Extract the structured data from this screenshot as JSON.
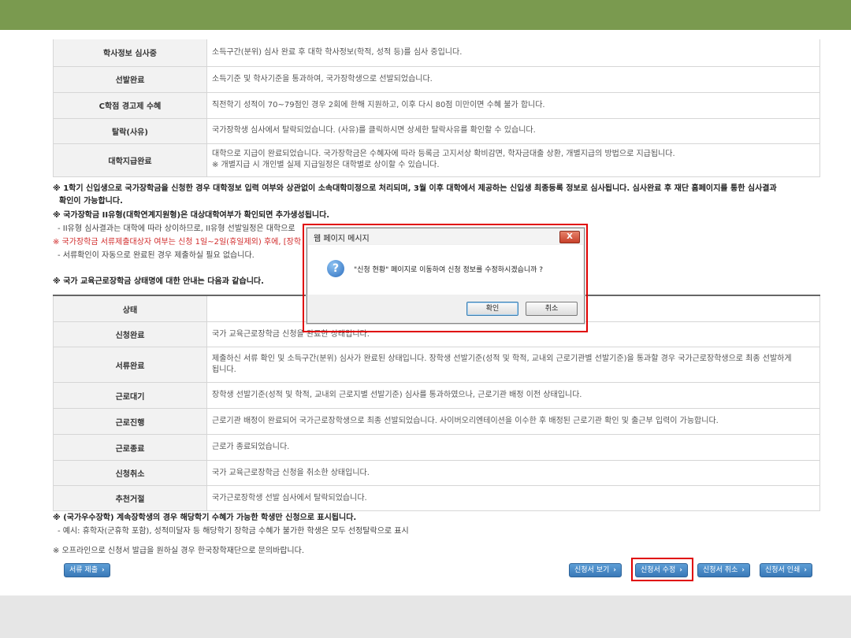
{
  "table1": [
    {
      "label": "학사정보 심사중",
      "desc": [
        "소득구간(분위) 심사 완료 후 대학 학사정보(학적, 성적 등)를 심사 중입니다."
      ]
    },
    {
      "label": "선발완료",
      "desc": [
        "소득기준 및 학사기준을 통과하여, 국가장학생으로 선발되었습니다."
      ]
    },
    {
      "label": "C학점 경고제 수혜",
      "desc": [
        "직전학기 성적이 70~79점인 경우 2회에 한해 지원하고, 이후 다시 80점 미만이면 수혜 불가 합니다."
      ]
    },
    {
      "label": "탈락(사유)",
      "desc": [
        "국가장학생 심사에서 탈락되었습니다. (사유)를 클릭하시면 상세한 탈락사유를 확인할 수 있습니다."
      ]
    },
    {
      "label": "대학지급완료",
      "desc": [
        "대학으로 지급이 완료되었습니다. 국가장학금은 수혜자에 따라 등록금 고지서상 확비감면, 학자금대출 상환, 개별지급의 방법으로 지급됩니다.",
        "※ 개별지급 시 개인별 실제 지급일정은 대학별로 상이할 수 있습니다."
      ]
    }
  ],
  "notes": {
    "n1a": "※ 1학기 신입생으로 국가장학금을 신청한 경우 대학정보 입력 여부와 상관없이 소속대학미정으로 처리되며, 3월 이후 대학에서 제공하는 신입생 최종등록 정보로 심사됩니다. 심사완료 후 재단 홈페이지를 통한 심사결과",
    "n1b": "확인이 가능합니다.",
    "n2": "※ 국가장학금 II유형(대학연계지원형)은 대상대학여부가 확인되면 추가생성됩니다.",
    "n3": "- II유형 심사결과는 대학에 따라 상이하므로, II유형 선발일정은 대학으로",
    "n4": "※ 국가장학금 서류제출대상자 여부는 신청 1일~2일(휴일제외) 후에, [장학",
    "n5": "- 서류확인이 자동으로 완료된 경우 제출하실 필요 없습니다.",
    "n6": "※ 국가 교육근로장학금 상태명에 대한 안내는 다음과 같습니다.",
    "n7": "※ (국가우수장학) 계속장학생의 경우 해당학기 수혜가 가능한 학생만 신청으로 표시됩니다.",
    "n8": "- 예시: 휴학자(군휴학 포함), 성적미달자 등 해당학기 장학금 수혜가 불가한 학생은 모두 선정탈락으로 표시",
    "n9": "※ 오프라인으로 신청서 발급을 원하실 경우 한국장학재단으로 문의바랍니다."
  },
  "table2": {
    "header": "상태",
    "rows": [
      {
        "label": "신청완료",
        "desc": [
          "국가 교육근로장학금 신청을 완료한 상태입니다."
        ]
      },
      {
        "label": "서류완료",
        "desc": [
          "제출하신 서류 확인 및 소득구간(분위) 심사가 완료된 상태입니다. 장학생 선발기준(성적 및 학적, 교내외 근로기관별 선발기준)을 통과할 경우 국가근로장학생으로 최종 선발하게",
          "됩니다."
        ]
      },
      {
        "label": "근로대기",
        "desc": [
          "장학생 선발기준(성적 및 학적, 교내외 근로지별 선발기준) 심사를 통과하였으나, 근로기관 배정 이전 상태입니다."
        ]
      },
      {
        "label": "근로진행",
        "desc": [
          "근로기관 배정이 완료되어 국가근로장학생으로 최종 선발되었습니다. 사이버오리엔테이션을 이수한 후 배정된 근로기관 확인 및 출근부 입력이 가능합니다."
        ]
      },
      {
        "label": "근로종료",
        "desc": [
          "근로가 종료되었습니다."
        ]
      },
      {
        "label": "신청취소",
        "desc": [
          "국가 교육근로장학금 신청을 취소한 상태입니다."
        ]
      },
      {
        "label": "추천거절",
        "desc": [
          "국가근로장학생 선발 심사에서 탈락되었습니다."
        ]
      }
    ]
  },
  "buttons": {
    "submit_docs": "서류 제출",
    "view": "신청서 보기",
    "edit": "신청서 수정",
    "cancel": "신청서 취소",
    "print": "신청서 인쇄"
  },
  "dialog": {
    "title": "웹 페이지 메시지",
    "close": "X",
    "icon": "?",
    "message": "\"신청 현황\" 페이지로 이동하여 신청 정보를 수정하시겠습니까 ?",
    "ok": "확인",
    "cancel": "취소"
  },
  "colors": {
    "topbar": "#7a9a4f",
    "button": "#3a79b8",
    "highlight": "#e00000",
    "red_note": "#d12a2a"
  }
}
